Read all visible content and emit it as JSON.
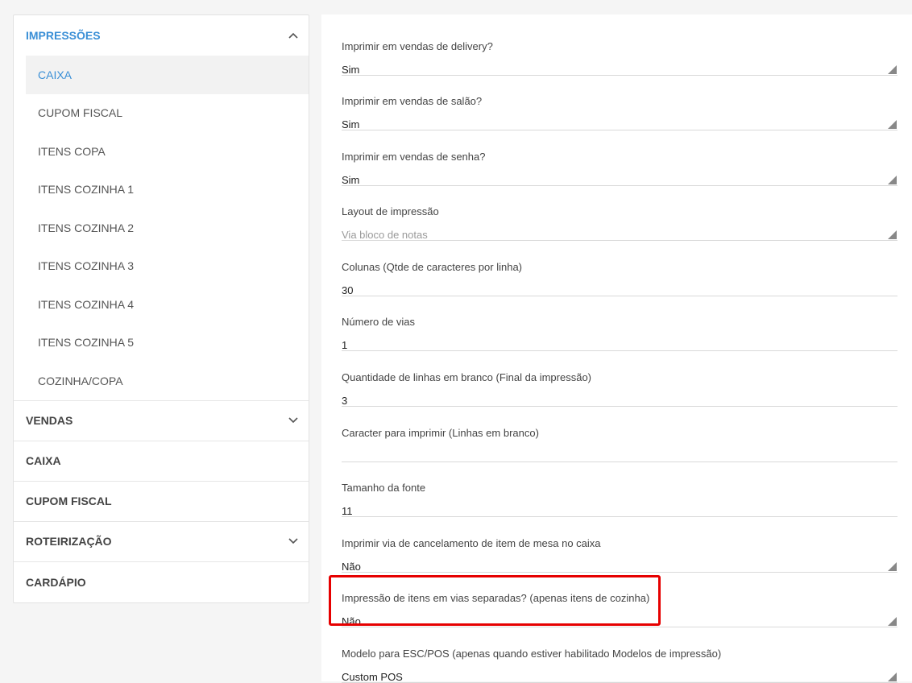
{
  "sidebar": {
    "open_section": {
      "label": "IMPRESSÕES",
      "icon": "chevron-up-icon",
      "items": [
        {
          "label": "CAIXA",
          "active": true
        },
        {
          "label": "CUPOM FISCAL"
        },
        {
          "label": "ITENS COPA"
        },
        {
          "label": "ITENS COZINHA 1"
        },
        {
          "label": "ITENS COZINHA 2"
        },
        {
          "label": "ITENS COZINHA 3"
        },
        {
          "label": "ITENS COZINHA 4"
        },
        {
          "label": "ITENS COZINHA 5"
        },
        {
          "label": "COZINHA/COPA"
        }
      ]
    },
    "sections": [
      {
        "label": "VENDAS",
        "icon": "chevron-down-icon"
      },
      {
        "label": "CAIXA"
      },
      {
        "label": "CUPOM FISCAL"
      },
      {
        "label": "ROTEIRIZAÇÃO",
        "icon": "chevron-down-icon"
      },
      {
        "label": "CARDÁPIO"
      }
    ]
  },
  "form": {
    "fields": [
      {
        "label": "Imprimir em vendas de delivery?",
        "value": "Sim",
        "type": "select"
      },
      {
        "label": "Imprimir em vendas de salão?",
        "value": "Sim",
        "type": "select"
      },
      {
        "label": "Imprimir em vendas de senha?",
        "value": "Sim",
        "type": "select"
      },
      {
        "label": "Layout de impressão",
        "placeholder": "Via bloco de notas",
        "type": "select"
      },
      {
        "label": "Colunas (Qtde de caracteres por linha)",
        "value": "30",
        "type": "input"
      },
      {
        "label": "Número de vias",
        "value": "1",
        "type": "input"
      },
      {
        "label": "Quantidade de linhas em branco (Final da impressão)",
        "value": "3",
        "type": "input"
      },
      {
        "label": "Caracter para imprimir (Linhas em branco)",
        "value": "",
        "type": "input"
      },
      {
        "label": "Tamanho da fonte",
        "value": "11",
        "type": "input"
      },
      {
        "label": "Imprimir via de cancelamento de item de mesa no caixa",
        "value": "Não",
        "type": "select"
      },
      {
        "label": "Impressão de itens em vias separadas? (apenas itens de cozinha)",
        "value": "Não",
        "type": "select"
      },
      {
        "label": "Modelo para ESC/POS (apenas quando estiver habilitado Modelos de impressão)",
        "value": "Custom POS",
        "type": "select"
      }
    ]
  },
  "colors": {
    "accent": "#3a8fd6",
    "highlight_border": "#e60000"
  }
}
